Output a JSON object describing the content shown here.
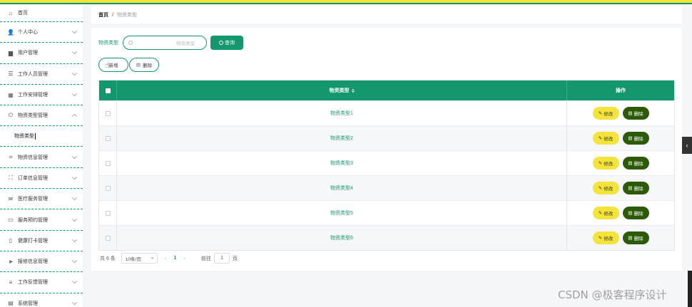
{
  "sidebar": {
    "items": [
      {
        "label": "首页",
        "icon": "home-icon",
        "glyph": "⌂"
      },
      {
        "label": "个人中心",
        "icon": "user-icon",
        "glyph": "👤"
      },
      {
        "label": "用户管理",
        "icon": "monitor-icon",
        "glyph": "▆"
      },
      {
        "label": "工作人员管理",
        "icon": "list-icon",
        "glyph": "☰"
      },
      {
        "label": "工作安排管理",
        "icon": "grid-icon",
        "glyph": "▦"
      },
      {
        "label": "物资类型管理",
        "icon": "power-icon",
        "glyph": "⏻"
      },
      {
        "label": "物资信息管理",
        "icon": "crop-icon",
        "glyph": "⌗"
      },
      {
        "label": "订单信息管理",
        "icon": "fullscreen-icon",
        "glyph": "⛶"
      },
      {
        "label": "医疗服务管理",
        "icon": "mail-icon",
        "glyph": "✉"
      },
      {
        "label": "服务预约管理",
        "icon": "printer-icon",
        "glyph": "▭"
      },
      {
        "label": "健康打卡管理",
        "icon": "phone-icon",
        "glyph": "▯"
      },
      {
        "label": "报修信息管理",
        "icon": "send-icon",
        "glyph": "➤"
      },
      {
        "label": "工作反馈管理",
        "icon": "sliders-icon",
        "glyph": "≡"
      },
      {
        "label": "系统管理",
        "icon": "clipboard-icon",
        "glyph": "▤"
      }
    ],
    "submenu_label": "物资类型"
  },
  "breadcrumb": {
    "home": "首页",
    "separator": "/",
    "current": "物资类型"
  },
  "search": {
    "label": "物资类型",
    "placeholder": "物资类型",
    "button": "查询"
  },
  "actions": {
    "add": "新增",
    "delete": "删除"
  },
  "table": {
    "headers": {
      "type": "物资类型",
      "operation": "操作"
    },
    "rows": [
      "物资类型1",
      "物资类型2",
      "物资类型3",
      "物资类型4",
      "物资类型5",
      "物资类型6"
    ],
    "edit_label": "修改",
    "delete_label": "删除"
  },
  "pagination": {
    "total": "共 6 条",
    "page_size": "10条/页",
    "prev": "‹",
    "current_page": "1",
    "next": "›",
    "goto_label": "前往",
    "goto_value": "1",
    "page_suffix": "页"
  },
  "side_tab": "‹",
  "watermark": "CSDN @极客程序设计",
  "colors": {
    "primary": "#14966f",
    "accent_yellow": "#f4e33a",
    "dark_green": "#2d5a09"
  }
}
